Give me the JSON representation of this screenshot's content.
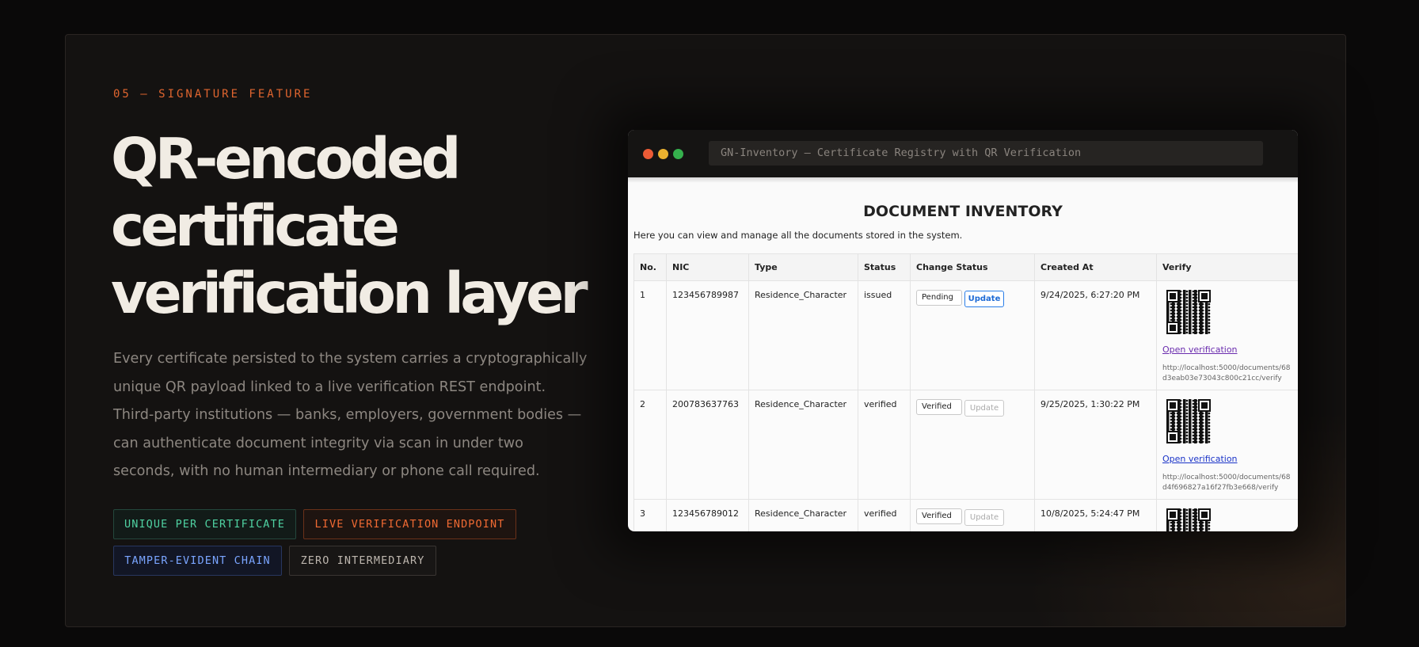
{
  "section": {
    "eyebrow": "05 — SIGNATURE FEATURE",
    "headline": "QR-encoded certificate verification layer",
    "body": "Every certificate persisted to the system carries a cryptographically unique QR payload linked to a live verification REST endpoint. Third-party institutions — banks, employers, government bodies — can authenticate document integrity via scan in under two seconds, with no human intermediary or phone call required.",
    "tags": [
      {
        "label": "UNIQUE PER CERTIFICATE",
        "color": "#4fd1a1"
      },
      {
        "label": "LIVE VERIFICATION ENDPOINT",
        "color": "#f06a33"
      },
      {
        "label": "TAMPER-EVIDENT CHAIN",
        "color": "#7aa5ff"
      },
      {
        "label": "ZERO INTERMEDIARY",
        "color": "#bdb6ae"
      }
    ]
  },
  "window": {
    "title": "GN-Inventory — Certificate Registry with QR Verification",
    "dot_colors": [
      "#ec5b36",
      "#eab12f",
      "#35b04d"
    ]
  },
  "inventory": {
    "title": "DOCUMENT INVENTORY",
    "subtitle": "Here you can view and manage all the documents stored in the system.",
    "columns": [
      "No.",
      "NIC",
      "Type",
      "Status",
      "Change Status",
      "Created At",
      "Verify"
    ],
    "rows": [
      {
        "no": "1",
        "nic": "123456789987",
        "type": "Residence_Character",
        "status": "issued",
        "select_value": "Pending",
        "update_label": "Update",
        "update_enabled": true,
        "created_at": "9/24/2025, 6:27:20 PM",
        "link_label": "Open verification",
        "url": "http://localhost:5000/documents/68d3eab03e73043c800c21cc/verify"
      },
      {
        "no": "2",
        "nic": "200783637763",
        "type": "Residence_Character",
        "status": "verified",
        "select_value": "Verified",
        "update_label": "Update",
        "update_enabled": false,
        "created_at": "9/25/2025, 1:30:22 PM",
        "link_label": "Open verification",
        "url": "http://localhost:5000/documents/68d4f696827a16f27fb3e668/verify"
      },
      {
        "no": "3",
        "nic": "123456789012",
        "type": "Residence_Character",
        "status": "verified",
        "select_value": "Verified",
        "update_label": "Update",
        "update_enabled": false,
        "created_at": "10/8/2025, 5:24:47 PM"
      }
    ]
  },
  "colors": {
    "accent_orange": "#e0652f",
    "headline": "#f1ece4",
    "body": "#8d8781"
  }
}
